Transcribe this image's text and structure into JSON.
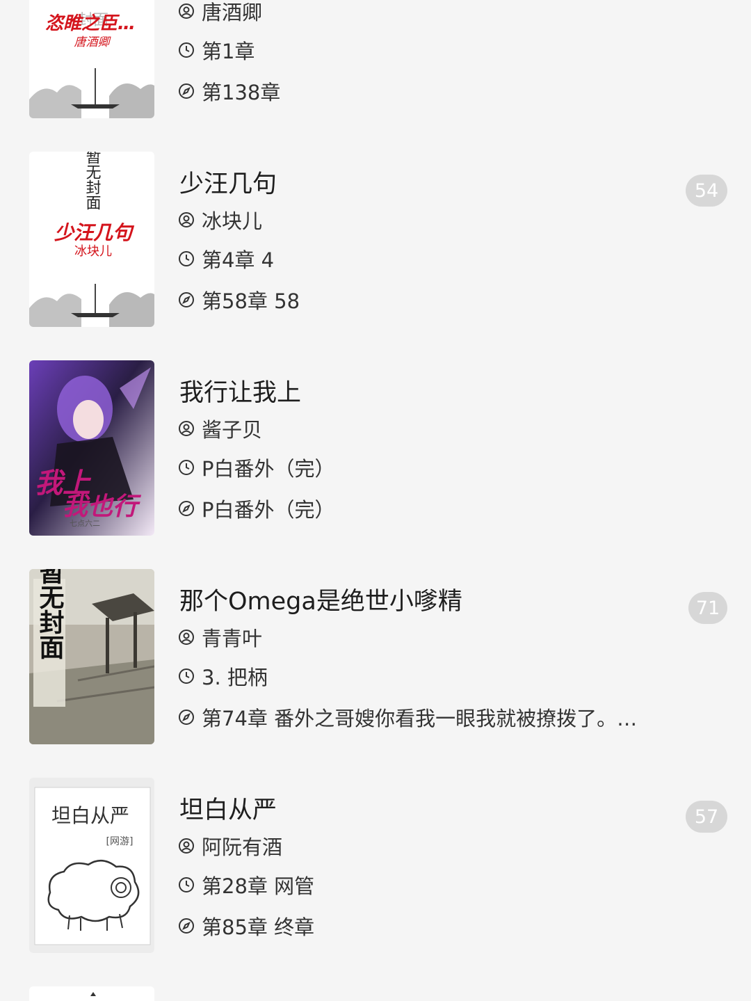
{
  "books": [
    {
      "cover_text": {
        "title": "恣睢之臣…",
        "author": "唐酒卿",
        "bg": "封面"
      },
      "title": "",
      "author": "唐酒卿",
      "last_read": "第1章",
      "latest": "第138章",
      "unread": ""
    },
    {
      "cover_text": {
        "placeholder": "暂无封面",
        "title": "少汪几句",
        "author": "冰块儿"
      },
      "title": "少汪几句",
      "author": "冰块儿",
      "last_read": "第4章 4",
      "latest": "第58章 58",
      "unread": "54"
    },
    {
      "cover_text": {
        "title_a": "我上",
        "title_b": "我也行",
        "author": "七点六二"
      },
      "title": "我行让我上",
      "author": "酱子贝",
      "last_read": "P白番外（完）",
      "latest": "P白番外（完）",
      "unread": ""
    },
    {
      "cover_text": {
        "placeholder": "暂无封面"
      },
      "title": "那个Omega是绝世小嗲精",
      "author": "青青叶",
      "last_read": "3. 把柄",
      "latest": "第74章 番外之哥嫂你看我一眼我就被撩拨了。…",
      "unread": "71"
    },
    {
      "cover_text": {
        "title": "坦白从严",
        "tag": "[网游]"
      },
      "title": "坦白从严",
      "author": "阿阮有酒",
      "last_read": "第28章 网管",
      "latest": "第85章 终章",
      "unread": "57"
    }
  ],
  "icons": {
    "author": "user-circle-icon",
    "last_read": "clock-icon",
    "latest": "compass-icon"
  },
  "colors": {
    "background": "#f5f5f5",
    "badge": "#d7d7d7",
    "cover_red": "#d4141c"
  }
}
